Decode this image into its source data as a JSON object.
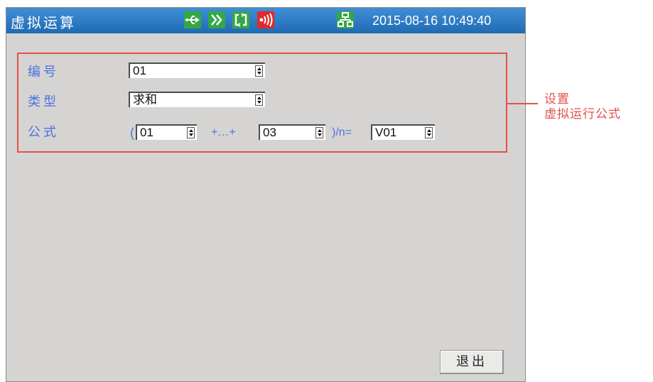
{
  "titlebar": {
    "title": "虚拟运算",
    "datetime": "2015-08-16 10:49:40",
    "icons": [
      "usb-icon",
      "forward-icon",
      "sync-icon",
      "alarm-icon",
      "network-icon"
    ]
  },
  "form": {
    "number": {
      "label": "编号",
      "value": "01"
    },
    "type": {
      "label": "类型",
      "value": "求和"
    },
    "formula": {
      "label": "公式",
      "open_paren": "(",
      "start": "01",
      "plus_text": "+…+",
      "end": "03",
      "divide_text": ")/n=",
      "result": "V01"
    }
  },
  "exit_button": "退出",
  "annotation": {
    "line1": "设置",
    "line2": "虚拟运行公式"
  },
  "colors": {
    "title_bar": "#2b7cc7",
    "label_blue": "#4b73e0",
    "annotation_red": "#e2504c",
    "status_green": "#33a845",
    "alarm_red": "#e02a2a"
  }
}
